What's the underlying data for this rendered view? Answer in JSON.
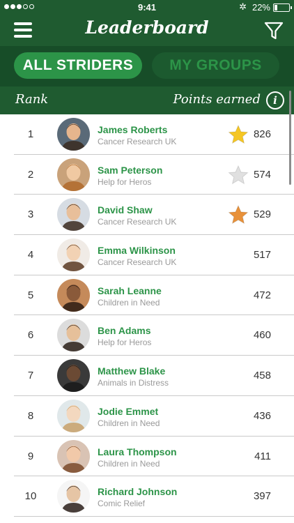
{
  "status": {
    "time": "9:41",
    "battery": "22%",
    "battery_level": 0.22,
    "signal_bars": [
      true,
      true,
      true,
      false,
      false
    ]
  },
  "header": {
    "title": "Leaderboard",
    "menu_icon": "hamburger-icon",
    "filter_icon": "filter-icon"
  },
  "tabs": [
    {
      "label": "ALL STRIDERS",
      "active": true
    },
    {
      "label": "MY GROUPS",
      "active": false
    }
  ],
  "columns": {
    "rank": "Rank",
    "points": "Points earned",
    "info_icon": "info-icon",
    "info_label": "i"
  },
  "colors": {
    "header_bg": "#1f5b30",
    "tabs_bg": "#174d28",
    "accent": "#2c9448",
    "gold": "#f5c623",
    "silver": "#e0e0e0",
    "bronze": "#e8913a"
  },
  "leaderboard": [
    {
      "rank": "1",
      "name": "James Roberts",
      "charity": "Cancer Research UK",
      "points": "826",
      "medal": "gold"
    },
    {
      "rank": "2",
      "name": "Sam Peterson",
      "charity": "Help for Heros",
      "points": "574",
      "medal": "silver"
    },
    {
      "rank": "3",
      "name": "David Shaw",
      "charity": "Cancer Research UK",
      "points": "529",
      "medal": "bronze"
    },
    {
      "rank": "4",
      "name": "Emma Wilkinson",
      "charity": "Cancer Research UK",
      "points": "517",
      "medal": ""
    },
    {
      "rank": "5",
      "name": "Sarah Leanne",
      "charity": "Children in Need",
      "points": "472",
      "medal": ""
    },
    {
      "rank": "6",
      "name": "Ben Adams",
      "charity": "Help for Heros",
      "points": "460",
      "medal": ""
    },
    {
      "rank": "7",
      "name": "Matthew Blake",
      "charity": "Animals in Distress",
      "points": "458",
      "medal": ""
    },
    {
      "rank": "8",
      "name": "Jodie Emmet",
      "charity": "Children in Need",
      "points": "436",
      "medal": ""
    },
    {
      "rank": "9",
      "name": "Laura Thompson",
      "charity": "Children in Need",
      "points": "411",
      "medal": ""
    },
    {
      "rank": "10",
      "name": "Richard Johnson",
      "charity": "Comic Relief",
      "points": "397",
      "medal": ""
    }
  ]
}
